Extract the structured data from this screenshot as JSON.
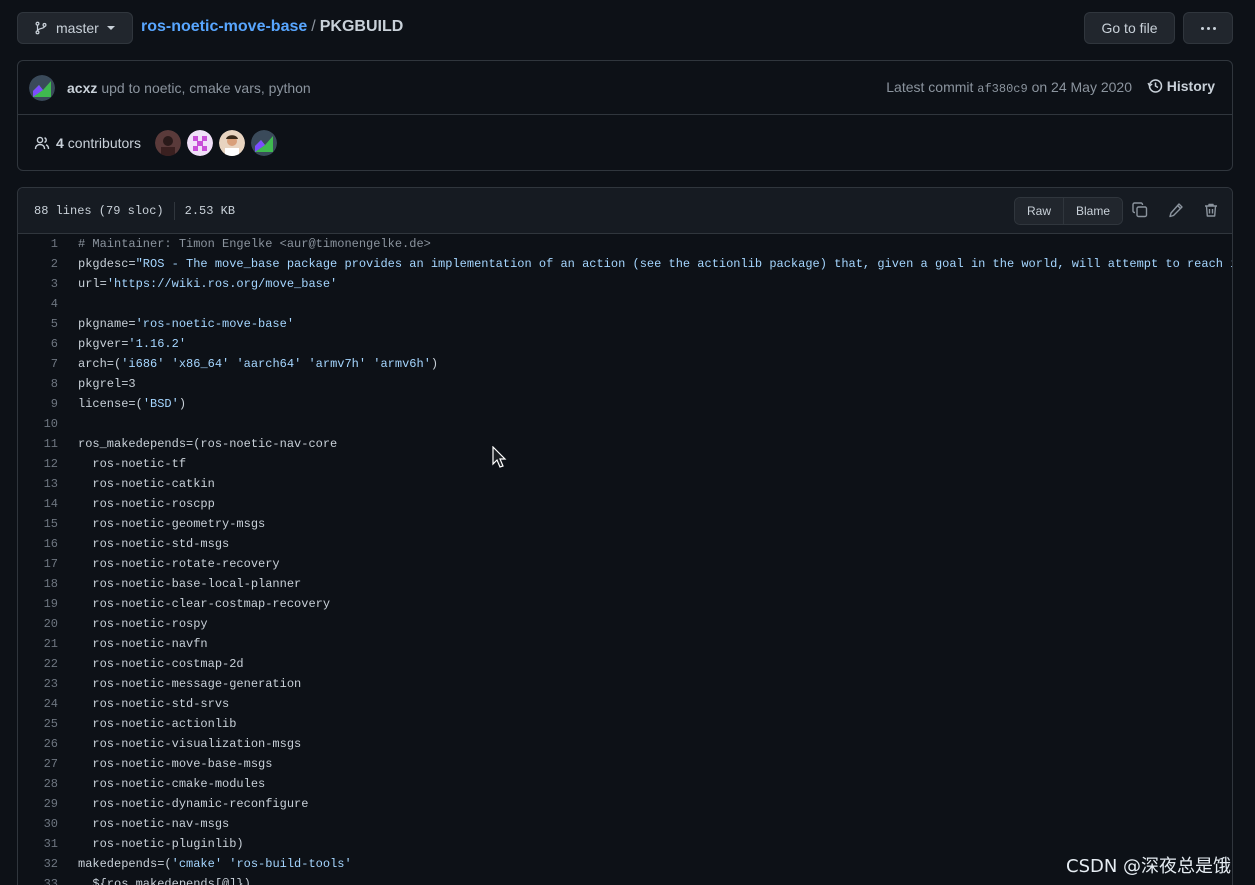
{
  "topbar": {
    "branch": "master",
    "repo": "ros-noetic-move-base",
    "separator": "/",
    "file": "PKGBUILD",
    "go_to_file": "Go to file"
  },
  "commit": {
    "author": "acxz",
    "message": "upd to noetic, cmake vars, python",
    "latest_prefix": "Latest commit",
    "sha": "af380c9",
    "date_text": "on 24 May 2020",
    "history": "History"
  },
  "contributors": {
    "count": "4",
    "label": "contributors"
  },
  "file_info": {
    "lines": "88 lines (79 sloc)",
    "size": "2.53 KB",
    "raw": "Raw",
    "blame": "Blame"
  },
  "code_lines": [
    {
      "n": "1",
      "t": "# Maintainer: Timon Engelke <aur@timonengelke.de>"
    },
    {
      "n": "2",
      "t": "pkgdesc=\"ROS - The move_base package provides an implementation of an action (see the actionlib package) that, given a goal in the world, will attempt to reach i"
    },
    {
      "n": "3",
      "t": "url='https://wiki.ros.org/move_base'"
    },
    {
      "n": "4",
      "t": ""
    },
    {
      "n": "5",
      "t": "pkgname='ros-noetic-move-base'"
    },
    {
      "n": "6",
      "t": "pkgver='1.16.2'"
    },
    {
      "n": "7",
      "t": "arch=('i686' 'x86_64' 'aarch64' 'armv7h' 'armv6h')"
    },
    {
      "n": "8",
      "t": "pkgrel=3"
    },
    {
      "n": "9",
      "t": "license=('BSD')"
    },
    {
      "n": "10",
      "t": ""
    },
    {
      "n": "11",
      "t": "ros_makedepends=(ros-noetic-nav-core"
    },
    {
      "n": "12",
      "t": "  ros-noetic-tf"
    },
    {
      "n": "13",
      "t": "  ros-noetic-catkin"
    },
    {
      "n": "14",
      "t": "  ros-noetic-roscpp"
    },
    {
      "n": "15",
      "t": "  ros-noetic-geometry-msgs"
    },
    {
      "n": "16",
      "t": "  ros-noetic-std-msgs"
    },
    {
      "n": "17",
      "t": "  ros-noetic-rotate-recovery"
    },
    {
      "n": "18",
      "t": "  ros-noetic-base-local-planner"
    },
    {
      "n": "19",
      "t": "  ros-noetic-clear-costmap-recovery"
    },
    {
      "n": "20",
      "t": "  ros-noetic-rospy"
    },
    {
      "n": "21",
      "t": "  ros-noetic-navfn"
    },
    {
      "n": "22",
      "t": "  ros-noetic-costmap-2d"
    },
    {
      "n": "23",
      "t": "  ros-noetic-message-generation"
    },
    {
      "n": "24",
      "t": "  ros-noetic-std-srvs"
    },
    {
      "n": "25",
      "t": "  ros-noetic-actionlib"
    },
    {
      "n": "26",
      "t": "  ros-noetic-visualization-msgs"
    },
    {
      "n": "27",
      "t": "  ros-noetic-move-base-msgs"
    },
    {
      "n": "28",
      "t": "  ros-noetic-cmake-modules"
    },
    {
      "n": "29",
      "t": "  ros-noetic-dynamic-reconfigure"
    },
    {
      "n": "30",
      "t": "  ros-noetic-nav-msgs"
    },
    {
      "n": "31",
      "t": "  ros-noetic-pluginlib)"
    },
    {
      "n": "32",
      "t": "makedepends=('cmake' 'ros-build-tools'"
    },
    {
      "n": "33",
      "t": "  ${ros_makedepends[@]})"
    }
  ],
  "watermark": "CSDN @深夜总是饿"
}
